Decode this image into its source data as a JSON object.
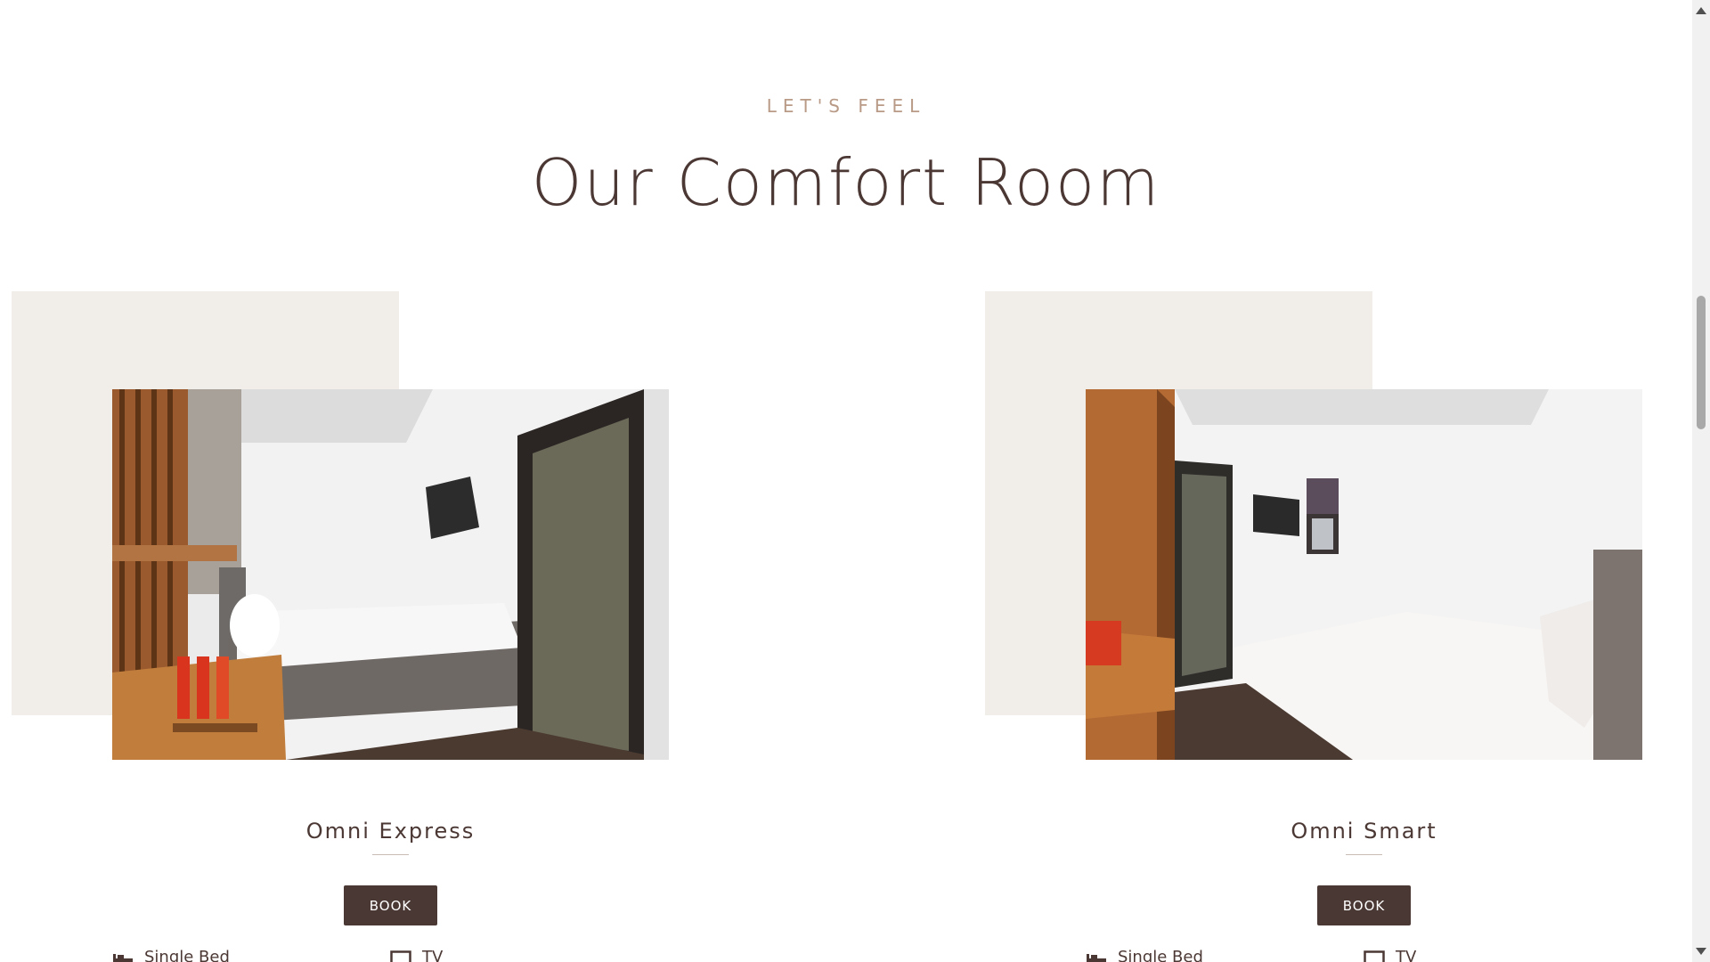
{
  "section": {
    "eyebrow": "LET'S FEEL",
    "title": "Our Comfort Room"
  },
  "rooms": [
    {
      "name": "Omni Express",
      "button": "BOOK",
      "amenities": [
        {
          "label": "Single Bed",
          "icon": "bed-icon"
        },
        {
          "label": "TV",
          "icon": "tv-icon"
        }
      ]
    },
    {
      "name": "Omni Smart",
      "button": "BOOK",
      "amenities": [
        {
          "label": "Single Bed",
          "icon": "bed-icon"
        },
        {
          "label": "TV",
          "icon": "tv-icon"
        }
      ]
    }
  ],
  "colors": {
    "accent": "#4a3834",
    "eyebrow": "#b89a86",
    "block": "#f1eeea"
  }
}
